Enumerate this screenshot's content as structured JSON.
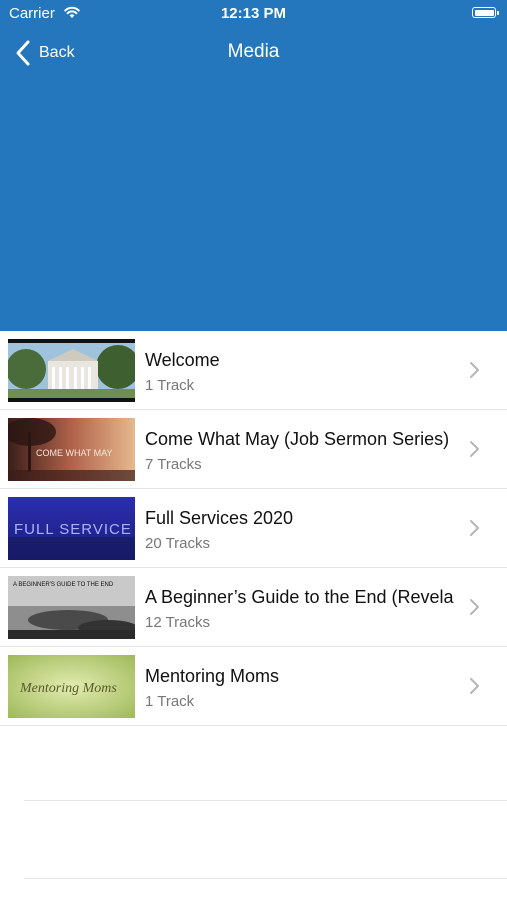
{
  "status_bar": {
    "carrier": "Carrier",
    "time": "12:13 PM"
  },
  "nav": {
    "back_label": "Back",
    "title": "Media"
  },
  "colors": {
    "header": "#2476bd",
    "separator": "#e3e3e3",
    "subtitle": "#777777"
  },
  "media_items": [
    {
      "title": "Welcome",
      "subtitle": "1 Track"
    },
    {
      "title": "Come What May (Job Sermon Series)",
      "subtitle": "7 Tracks",
      "thumb_text": "COME WHAT MAY"
    },
    {
      "title": "Full Services 2020",
      "subtitle": "20 Tracks",
      "thumb_text": "FULL SERVICE"
    },
    {
      "title": "A Beginner’s Guide to the End (Revela",
      "subtitle": "12 Tracks",
      "thumb_text": "A BEGINNER'S GUIDE TO THE END"
    },
    {
      "title": "Mentoring Moms",
      "subtitle": "1 Track",
      "thumb_text": "Mentoring Moms"
    }
  ]
}
